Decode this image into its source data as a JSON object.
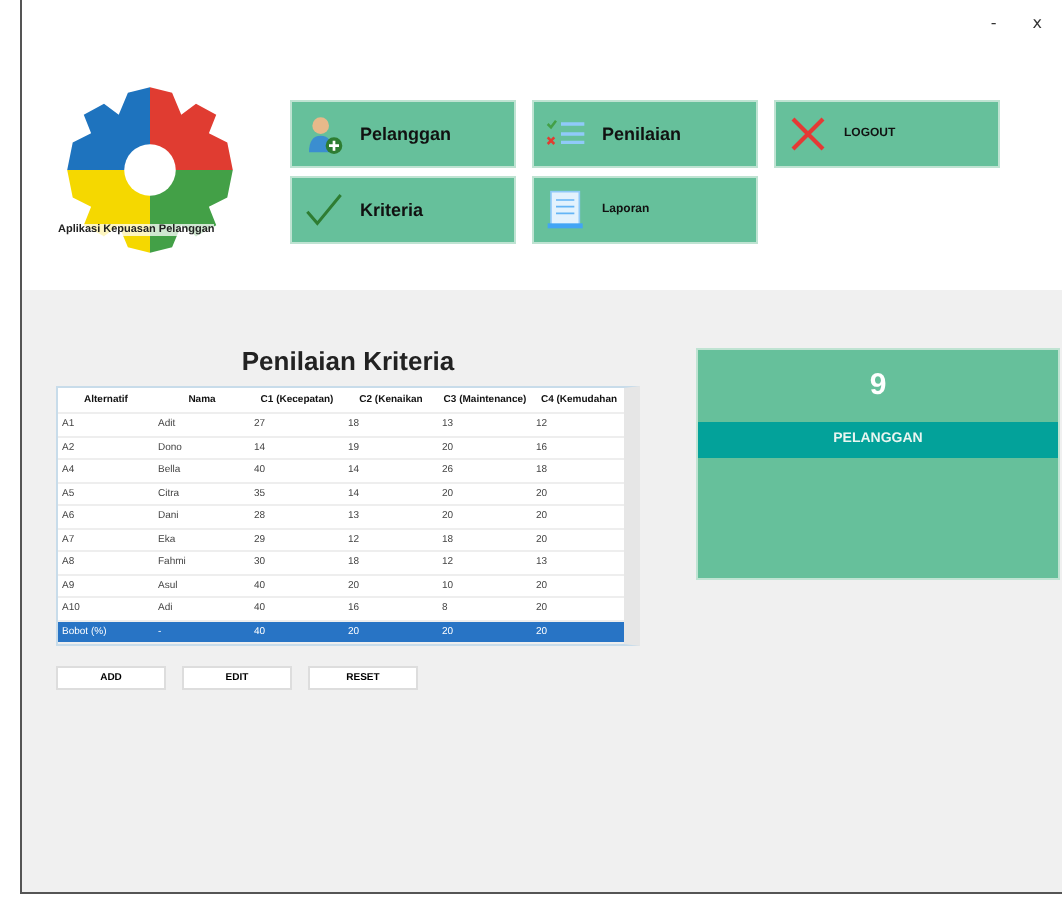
{
  "window": {
    "controls": [
      "-",
      "x"
    ]
  },
  "logo": {
    "caption": "Aplikasi Kepuasan Pelanggan"
  },
  "menu": [
    {
      "label": "Pelanggan"
    },
    {
      "label": "Penilaian"
    },
    {
      "label": "LOGOUT"
    },
    {
      "label": "Kriteria"
    },
    {
      "label": "Laporan"
    }
  ],
  "panel": {
    "title": "Penilaian Kriteria",
    "table": {
      "columns": [
        "Alternatif",
        "Nama",
        "C1 (Kecepatan)",
        "C2 (Kenaikan",
        "C3 (Maintenance)",
        "C4 (Kemudahan"
      ],
      "rows": [
        {
          "cells": [
            "A1",
            "Adit",
            "27",
            "18",
            "13",
            "12"
          ],
          "selected": false
        },
        {
          "cells": [
            "A2",
            "Dono",
            "14",
            "19",
            "20",
            "16"
          ],
          "selected": false
        },
        {
          "cells": [
            "A4",
            "Bella",
            "40",
            "14",
            "26",
            "18"
          ],
          "selected": false
        },
        {
          "cells": [
            "A5",
            "Citra",
            "35",
            "14",
            "20",
            "20"
          ],
          "selected": false
        },
        {
          "cells": [
            "A6",
            "Dani",
            "28",
            "13",
            "20",
            "20"
          ],
          "selected": false
        },
        {
          "cells": [
            "A7",
            "Eka",
            "29",
            "12",
            "18",
            "20"
          ],
          "selected": false
        },
        {
          "cells": [
            "A8",
            "Fahmi",
            "30",
            "18",
            "12",
            "13"
          ],
          "selected": false
        },
        {
          "cells": [
            "A9",
            "Asul",
            "40",
            "20",
            "10",
            "20"
          ],
          "selected": false
        },
        {
          "cells": [
            "A10",
            "Adi",
            "40",
            "16",
            "8",
            "20"
          ],
          "selected": false
        },
        {
          "cells": [
            "Bobot (%)",
            "-",
            "40",
            "20",
            "20",
            "20"
          ],
          "selected": true
        }
      ]
    },
    "buttons": [
      "ADD",
      "EDIT",
      "RESET"
    ]
  },
  "stat": {
    "value": "9",
    "label": "PELANGGAN"
  }
}
